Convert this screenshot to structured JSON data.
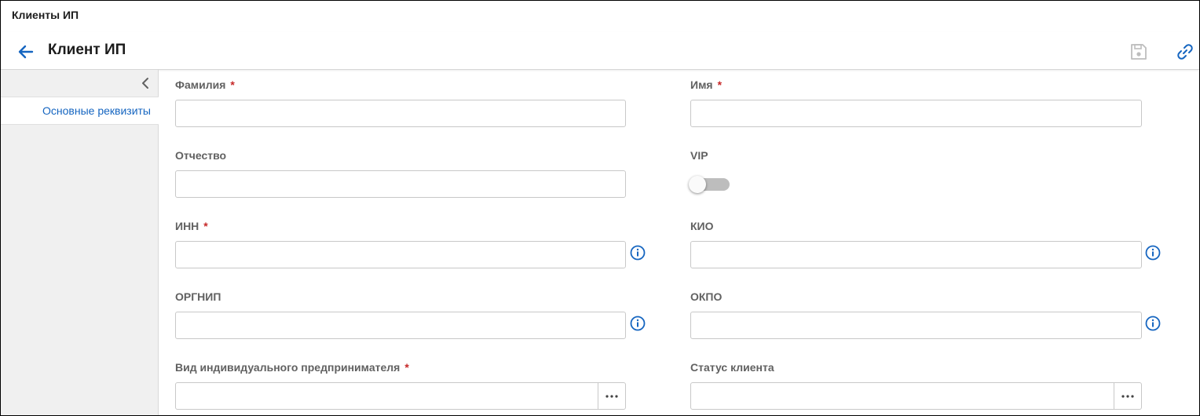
{
  "breadcrumb": "Клиенты ИП",
  "header": {
    "title": "Клиент ИП",
    "icons": {
      "back": "arrow-left-icon",
      "save": "save-icon",
      "link": "link-icon"
    },
    "accent_color": "#1565c0"
  },
  "sidebar": {
    "collapse_icon": "chevron-left-icon",
    "items": [
      {
        "label": "Основные реквизиты",
        "active": true
      }
    ]
  },
  "form": {
    "surname": {
      "label": "Фамилия",
      "required": "*",
      "value": ""
    },
    "name": {
      "label": "Имя",
      "required": "*",
      "value": ""
    },
    "patronymic": {
      "label": "Отчество",
      "value": ""
    },
    "vip": {
      "label": "VIP",
      "checked": false
    },
    "inn": {
      "label": "ИНН",
      "required": "*",
      "value": "",
      "info_icon": "info-icon"
    },
    "kio": {
      "label": "КИО",
      "value": "",
      "info_icon": "info-icon"
    },
    "ogrnip": {
      "label": "ОРГНИП",
      "value": "",
      "info_icon": "info-icon"
    },
    "okpo": {
      "label": "ОКПО",
      "value": "",
      "info_icon": "info-icon"
    },
    "entrepreneur_type": {
      "label": "Вид индивидуального предпринимателя",
      "required": "*",
      "value": "",
      "picker_icon": "ellipsis-icon"
    },
    "client_status": {
      "label": "Статус клиента",
      "value": "",
      "picker_icon": "ellipsis-icon"
    }
  },
  "colors": {
    "required": "#c62828",
    "label": "#616161",
    "toggle_off": "#bdbdbd"
  }
}
